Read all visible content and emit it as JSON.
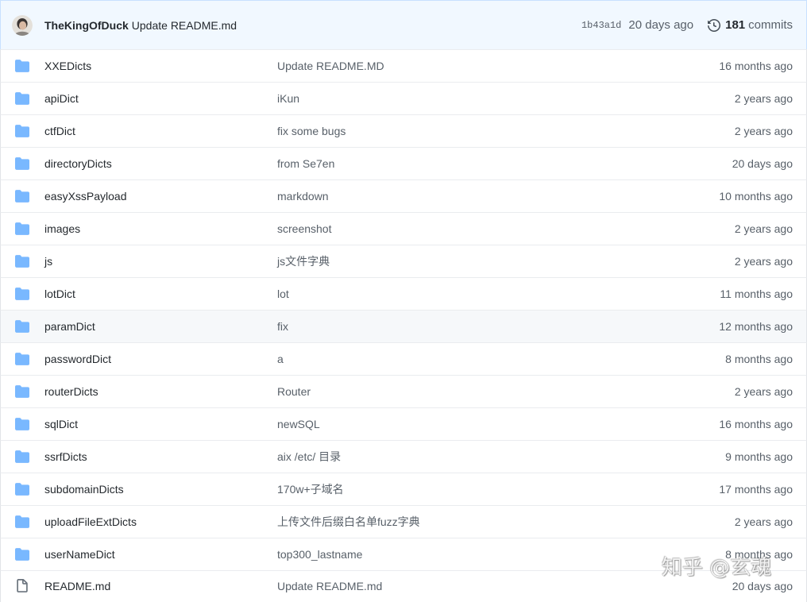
{
  "colors": {
    "header_background": "#f1f8ff",
    "header_border": "#c8e1ff",
    "folder_icon": "#79b8ff",
    "file_icon": "#6a737d",
    "row_hover": "#f6f8fa",
    "text_primary": "#24292e",
    "text_secondary": "#586069"
  },
  "latest_commit": {
    "author": "TheKingOfDuck",
    "message": "Update README.md",
    "sha": "1b43a1d",
    "age": "20 days ago",
    "commits": {
      "icon": "history-icon",
      "count": "181",
      "label": "commits"
    }
  },
  "files": [
    {
      "icon": "folder-icon",
      "name": "XXEDicts",
      "message": "Update README.MD",
      "age": "16 months ago"
    },
    {
      "icon": "folder-icon",
      "name": "apiDict",
      "message": "iKun",
      "age": "2 years ago"
    },
    {
      "icon": "folder-icon",
      "name": "ctfDict",
      "message": "fix some bugs",
      "age": "2 years ago"
    },
    {
      "icon": "folder-icon",
      "name": "directoryDicts",
      "message": "from Se7en",
      "age": "20 days ago"
    },
    {
      "icon": "folder-icon",
      "name": "easyXssPayload",
      "message": "markdown",
      "age": "10 months ago"
    },
    {
      "icon": "folder-icon",
      "name": "images",
      "message": "screenshot",
      "age": "2 years ago"
    },
    {
      "icon": "folder-icon",
      "name": "js",
      "message": "js文件字典",
      "age": "2 years ago"
    },
    {
      "icon": "folder-icon",
      "name": "lotDict",
      "message": "lot",
      "age": "11 months ago"
    },
    {
      "icon": "folder-icon",
      "name": "paramDict",
      "message": "fix",
      "age": "12 months ago",
      "hovered": true
    },
    {
      "icon": "folder-icon",
      "name": "passwordDict",
      "message": "a",
      "age": "8 months ago"
    },
    {
      "icon": "folder-icon",
      "name": "routerDicts",
      "message": "Router",
      "age": "2 years ago"
    },
    {
      "icon": "folder-icon",
      "name": "sqlDict",
      "message": "newSQL",
      "age": "16 months ago"
    },
    {
      "icon": "folder-icon",
      "name": "ssrfDicts",
      "message": "aix /etc/ 目录",
      "age": "9 months ago"
    },
    {
      "icon": "folder-icon",
      "name": "subdomainDicts",
      "message": "170w+子域名",
      "age": "17 months ago"
    },
    {
      "icon": "folder-icon",
      "name": "uploadFileExtDicts",
      "message": "上传文件后缀白名单fuzz字典",
      "age": "2 years ago"
    },
    {
      "icon": "folder-icon",
      "name": "userNameDict",
      "message": "top300_lastname",
      "age": "8 months ago"
    },
    {
      "icon": "file-icon",
      "name": "README.md",
      "message": "Update README.md",
      "age": "20 days ago"
    }
  ],
  "watermark": {
    "text": "知乎 @玄魂"
  }
}
